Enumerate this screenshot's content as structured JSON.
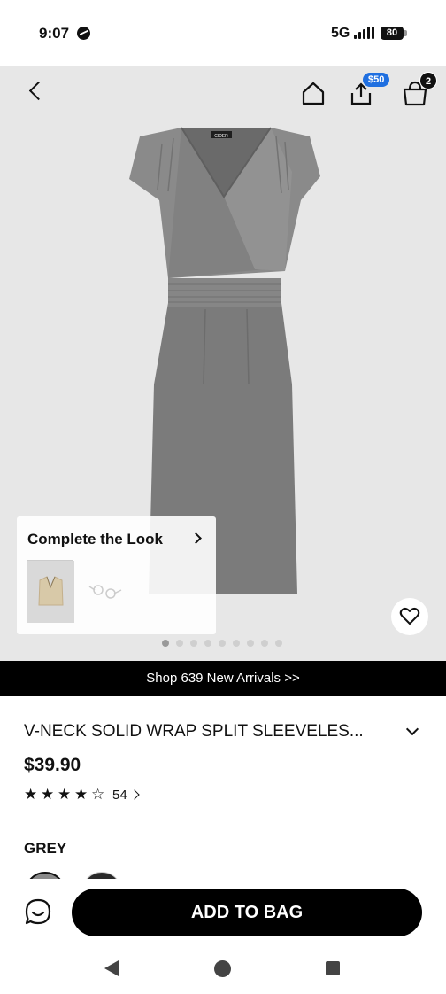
{
  "status_bar": {
    "time": "9:07",
    "network": "5G",
    "battery": "80",
    "icons": [
      "messenger-icon",
      "signal-icon",
      "battery-icon"
    ]
  },
  "header": {
    "icons": [
      "back-icon",
      "home-icon",
      "share-icon",
      "shopping-bag-icon"
    ],
    "coupon_badge": "$50",
    "cart_count": "2"
  },
  "gallery": {
    "brand_tag": "CIDER",
    "image_count": 9,
    "active_index": 0,
    "colors": {
      "dress": "#7d7d7d",
      "background": "#e7e7e7"
    }
  },
  "complete_the_look": {
    "title": "Complete the Look",
    "items": [
      "vest-top-thumbnail",
      "earrings-thumbnail"
    ]
  },
  "promo": {
    "text": "Shop 639 New Arrivals >>"
  },
  "product": {
    "title": "V-NECK SOLID WRAP SPLIT SLEEVELES...",
    "price": "$39.90",
    "rating": 4.5,
    "reviews": "54"
  },
  "color_section": {
    "label": "GREY",
    "swatches": [
      "#8a8a8a",
      "#2a2a2a"
    ]
  },
  "actions": {
    "add_to_bag": "ADD TO BAG",
    "chat_icon": "chat-icon"
  },
  "system_nav": [
    "back-triangle-icon",
    "home-circle-icon",
    "recents-square-icon"
  ]
}
